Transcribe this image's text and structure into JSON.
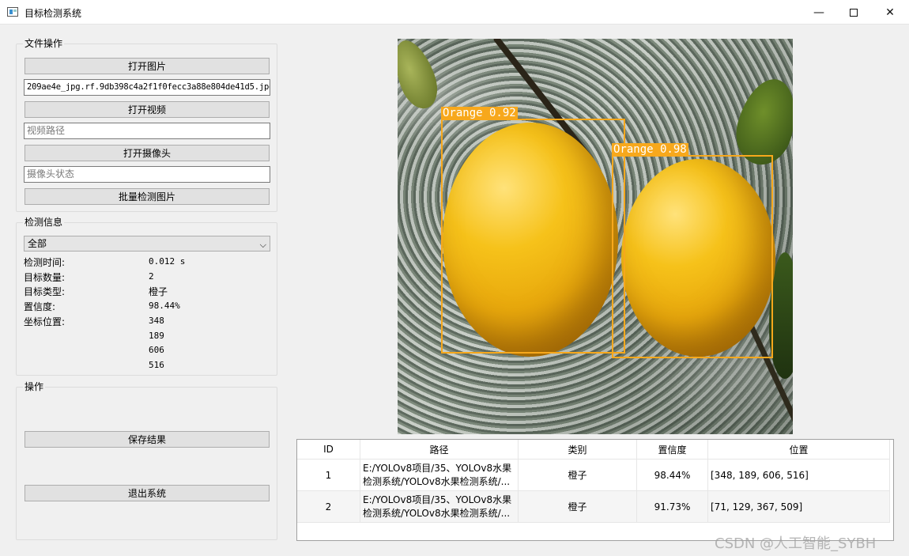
{
  "window": {
    "title": "目标检测系统",
    "min_icon": "—",
    "close_icon": "✕"
  },
  "file_ops": {
    "title": "文件操作",
    "open_image": "打开图片",
    "image_path": "209ae4e_jpg.rf.9db398c4a2f1f0fecc3a88e804de41d5.jpg",
    "open_video": "打开视频",
    "video_placeholder": "视频路径",
    "open_camera": "打开摄像头",
    "camera_placeholder": "摄像头状态",
    "batch_detect": "批量检测图片"
  },
  "detect_info": {
    "title": "检测信息",
    "combo_selected": "全部",
    "combo_arrow": "⌵",
    "time_label": "检测时间:",
    "time_value": "0.012 s",
    "count_label": "目标数量:",
    "count_value": "2",
    "type_label": "目标类型:",
    "type_value": "橙子",
    "conf_label": "置信度:",
    "conf_value": "98.44%",
    "pos_label": "坐标位置:",
    "pos_values": [
      "348",
      "189",
      "606",
      "516"
    ]
  },
  "ops": {
    "title": "操作",
    "save": "保存结果",
    "exit": "退出系统"
  },
  "detections": [
    {
      "label": "Orange 0.92"
    },
    {
      "label": "Orange 0.98"
    }
  ],
  "table": {
    "headers": [
      "ID",
      "路径",
      "类别",
      "置信度",
      "位置"
    ],
    "rows": [
      {
        "id": "1",
        "path": "E:/YOLOv8项目/35、YOLOv8水果检测系统/YOLOv8水果检测系统/...",
        "type": "橙子",
        "conf": "98.44%",
        "pos": "[348, 189, 606, 516]"
      },
      {
        "id": "2",
        "path": "E:/YOLOv8项目/35、YOLOv8水果检测系统/YOLOv8水果检测系统/...",
        "type": "橙子",
        "conf": "91.73%",
        "pos": "[71, 129, 367, 509]"
      }
    ]
  },
  "watermark": "CSDN @人工智能_SYBH"
}
